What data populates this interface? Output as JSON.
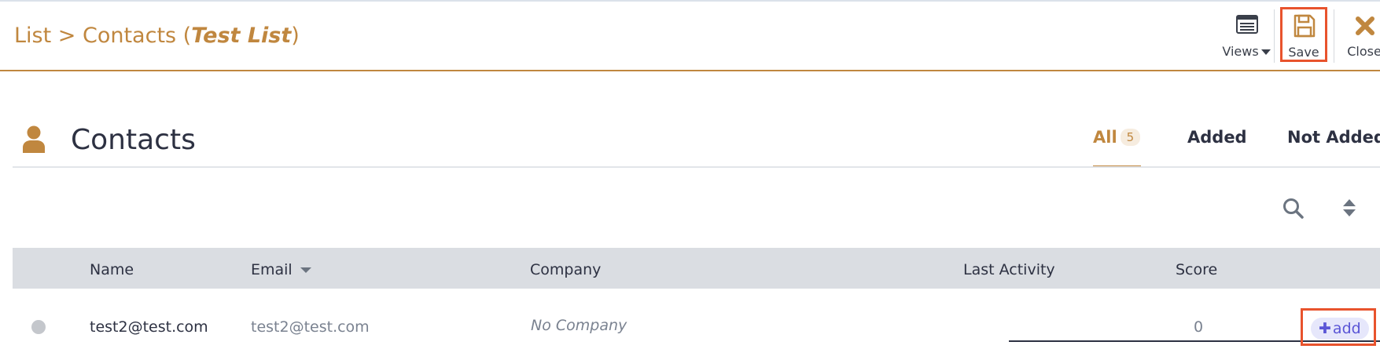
{
  "header": {
    "breadcrumb_prefix": "List > Contacts (",
    "list_name": "Test List",
    "breadcrumb_suffix": ")",
    "accent_color": "#c0873f"
  },
  "toolbar": {
    "views_label": "Views",
    "save_label": "Save",
    "close_label": "Close",
    "highlight_color": "#e8532d"
  },
  "section": {
    "title": "Contacts",
    "icon": "person-icon"
  },
  "tabs": [
    {
      "label": "All",
      "count": "5",
      "active": true
    },
    {
      "label": "Added"
    },
    {
      "label": "Not Added"
    }
  ],
  "table": {
    "columns": [
      "Name",
      "Email",
      "Company",
      "Last Activity",
      "Score"
    ],
    "sorted_column": "Email",
    "rows": [
      {
        "name": "test2@test.com",
        "email": "test2@test.com",
        "company": "No Company",
        "last_activity": "",
        "score": "0",
        "action_label": "add"
      }
    ]
  }
}
